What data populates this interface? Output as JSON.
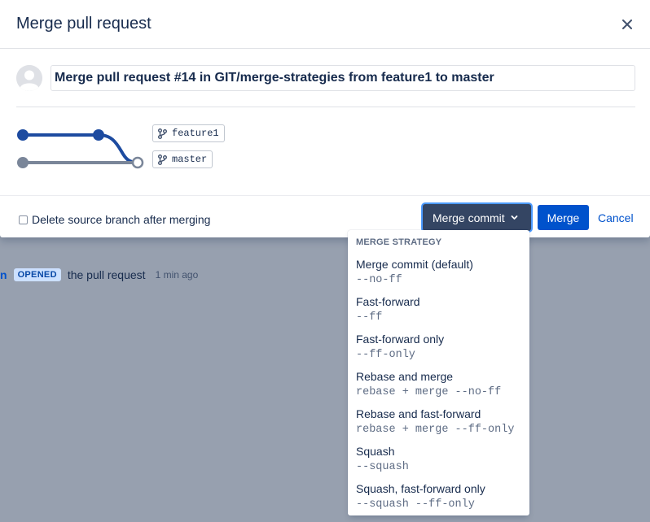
{
  "modal": {
    "title": "Merge pull request",
    "commit_message": "Merge pull request #14 in GIT/merge-strategies from feature1 to master",
    "source_branch": "feature1",
    "target_branch": "master",
    "delete_branch_label": "Delete source branch after merging",
    "delete_branch_checked": false,
    "strategy_button_label": "Merge commit",
    "merge_button_label": "Merge",
    "cancel_button_label": "Cancel"
  },
  "dropdown": {
    "heading": "MERGE STRATEGY",
    "items": [
      {
        "label": "Merge commit (default)",
        "flag": "--no-ff"
      },
      {
        "label": "Fast-forward",
        "flag": "--ff"
      },
      {
        "label": "Fast-forward only",
        "flag": "--ff-only"
      },
      {
        "label": "Rebase and merge",
        "flag": "rebase + merge --no-ff"
      },
      {
        "label": "Rebase and fast-forward",
        "flag": "rebase + merge --ff-only"
      },
      {
        "label": "Squash",
        "flag": "--squash"
      },
      {
        "label": "Squash, fast-forward only",
        "flag": "--squash --ff-only"
      }
    ]
  },
  "activity": {
    "user": "n",
    "badge": "OPENED",
    "text": "the pull request",
    "time": "1 min ago"
  },
  "colors": {
    "primary": "#0052cc",
    "strategy_button": "#344563",
    "source_branch_line": "#1d4ba0",
    "target_branch_line": "#7a8699",
    "backdrop": "#97a0af"
  },
  "icons": {
    "close": "close-icon",
    "branch": "branch-icon",
    "chevron": "chevron-down-icon",
    "avatar": "default-avatar-icon"
  }
}
